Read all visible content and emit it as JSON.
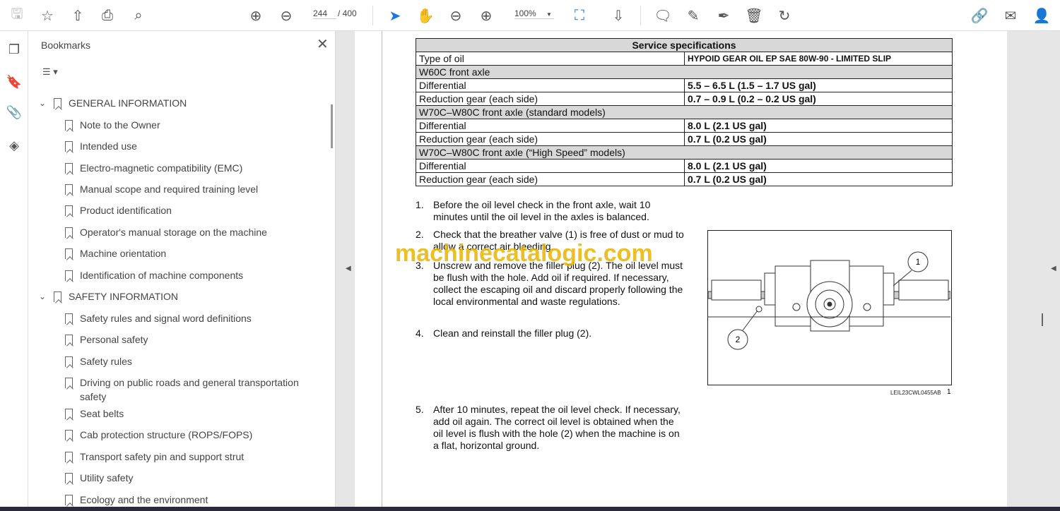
{
  "toolbar": {
    "page_current": "244",
    "page_total": "/ 400",
    "zoom": "100%"
  },
  "panel": {
    "title": "Bookmarks"
  },
  "bookmarks": [
    {
      "label": "GENERAL INFORMATION",
      "level": 0
    },
    {
      "label": "Note to the Owner",
      "level": 1
    },
    {
      "label": "Intended use",
      "level": 1
    },
    {
      "label": "Electro-magnetic compatibility (EMC)",
      "level": 1
    },
    {
      "label": "Manual scope and required training level",
      "level": 1
    },
    {
      "label": "Product identification",
      "level": 1
    },
    {
      "label": "Operator's manual storage on the machine",
      "level": 1
    },
    {
      "label": "Machine orientation",
      "level": 1
    },
    {
      "label": "Identification of machine components",
      "level": 1
    },
    {
      "label": "SAFETY INFORMATION",
      "level": 0
    },
    {
      "label": "Safety rules and signal word definitions",
      "level": 1
    },
    {
      "label": "Personal safety",
      "level": 1
    },
    {
      "label": "Safety rules",
      "level": 1
    },
    {
      "label": "Driving on public roads and general transportation safety",
      "level": 1
    },
    {
      "label": "Seat belts",
      "level": 1
    },
    {
      "label": "Cab protection structure (ROPS/FOPS)",
      "level": 1
    },
    {
      "label": "Transport safety pin and support strut",
      "level": 1
    },
    {
      "label": "Utility safety",
      "level": 1
    },
    {
      "label": "Ecology and the environment",
      "level": 1
    }
  ],
  "doc": {
    "table_title": "Service specifications",
    "rows": [
      {
        "type": "kv",
        "k": "Type of oil",
        "v": "HYPOID GEAR OIL EP SAE 80W-90 - LIMITED SLIP"
      },
      {
        "type": "h",
        "k": "W60C front axle"
      },
      {
        "type": "kv",
        "k": "Differential",
        "v": "5.5 – 6.5 L (1.5 – 1.7 US gal)"
      },
      {
        "type": "kv",
        "k": "Reduction gear (each side)",
        "v": "0.7 – 0.9 L (0.2 – 0.2 US gal)"
      },
      {
        "type": "h",
        "k": "W70C–W80C front axle (standard models)"
      },
      {
        "type": "kv",
        "k": "Differential",
        "v": "8.0 L (2.1 US gal)"
      },
      {
        "type": "kv",
        "k": "Reduction gear (each side)",
        "v": "0.7 L (0.2 US gal)"
      },
      {
        "type": "h",
        "k": "W70C–W80C front axle (“High Speed” models)"
      },
      {
        "type": "kv",
        "k": "Differential",
        "v": "8.0 L (2.1 US gal)"
      },
      {
        "type": "kv",
        "k": "Reduction gear (each side)",
        "v": "0.7 L (0.2 US gal)"
      }
    ],
    "steps": [
      {
        "n": "1.",
        "t": "Before the oil level check in the front axle, wait 10 minutes until the oil level in the axles is balanced."
      },
      {
        "n": "2.",
        "t": "Check that the breather valve (1) is free of dust or mud to allow a correct air bleeding."
      },
      {
        "n": "3.",
        "t": "Unscrew and remove the filler plug (2). The oil level must be flush with the hole. Add oil if required. If necessary, collect the escaping oil and discard properly following the local environmental and waste regulations."
      },
      {
        "n": "4.",
        "t": "Clean and reinstall the filler plug (2)."
      },
      {
        "n": "5.",
        "t": "After 10 minutes, repeat the oil level check. If necessary, add oil again. The correct oil level is obtained when the oil level is flush with the hole (2) when the machine is on a flat, horizontal ground."
      }
    ],
    "figure_caption": "LEIL23CWL0455AB",
    "figure_number": "1",
    "callout_1": "1",
    "callout_2": "2",
    "watermark": "machinecatalogic.com"
  }
}
